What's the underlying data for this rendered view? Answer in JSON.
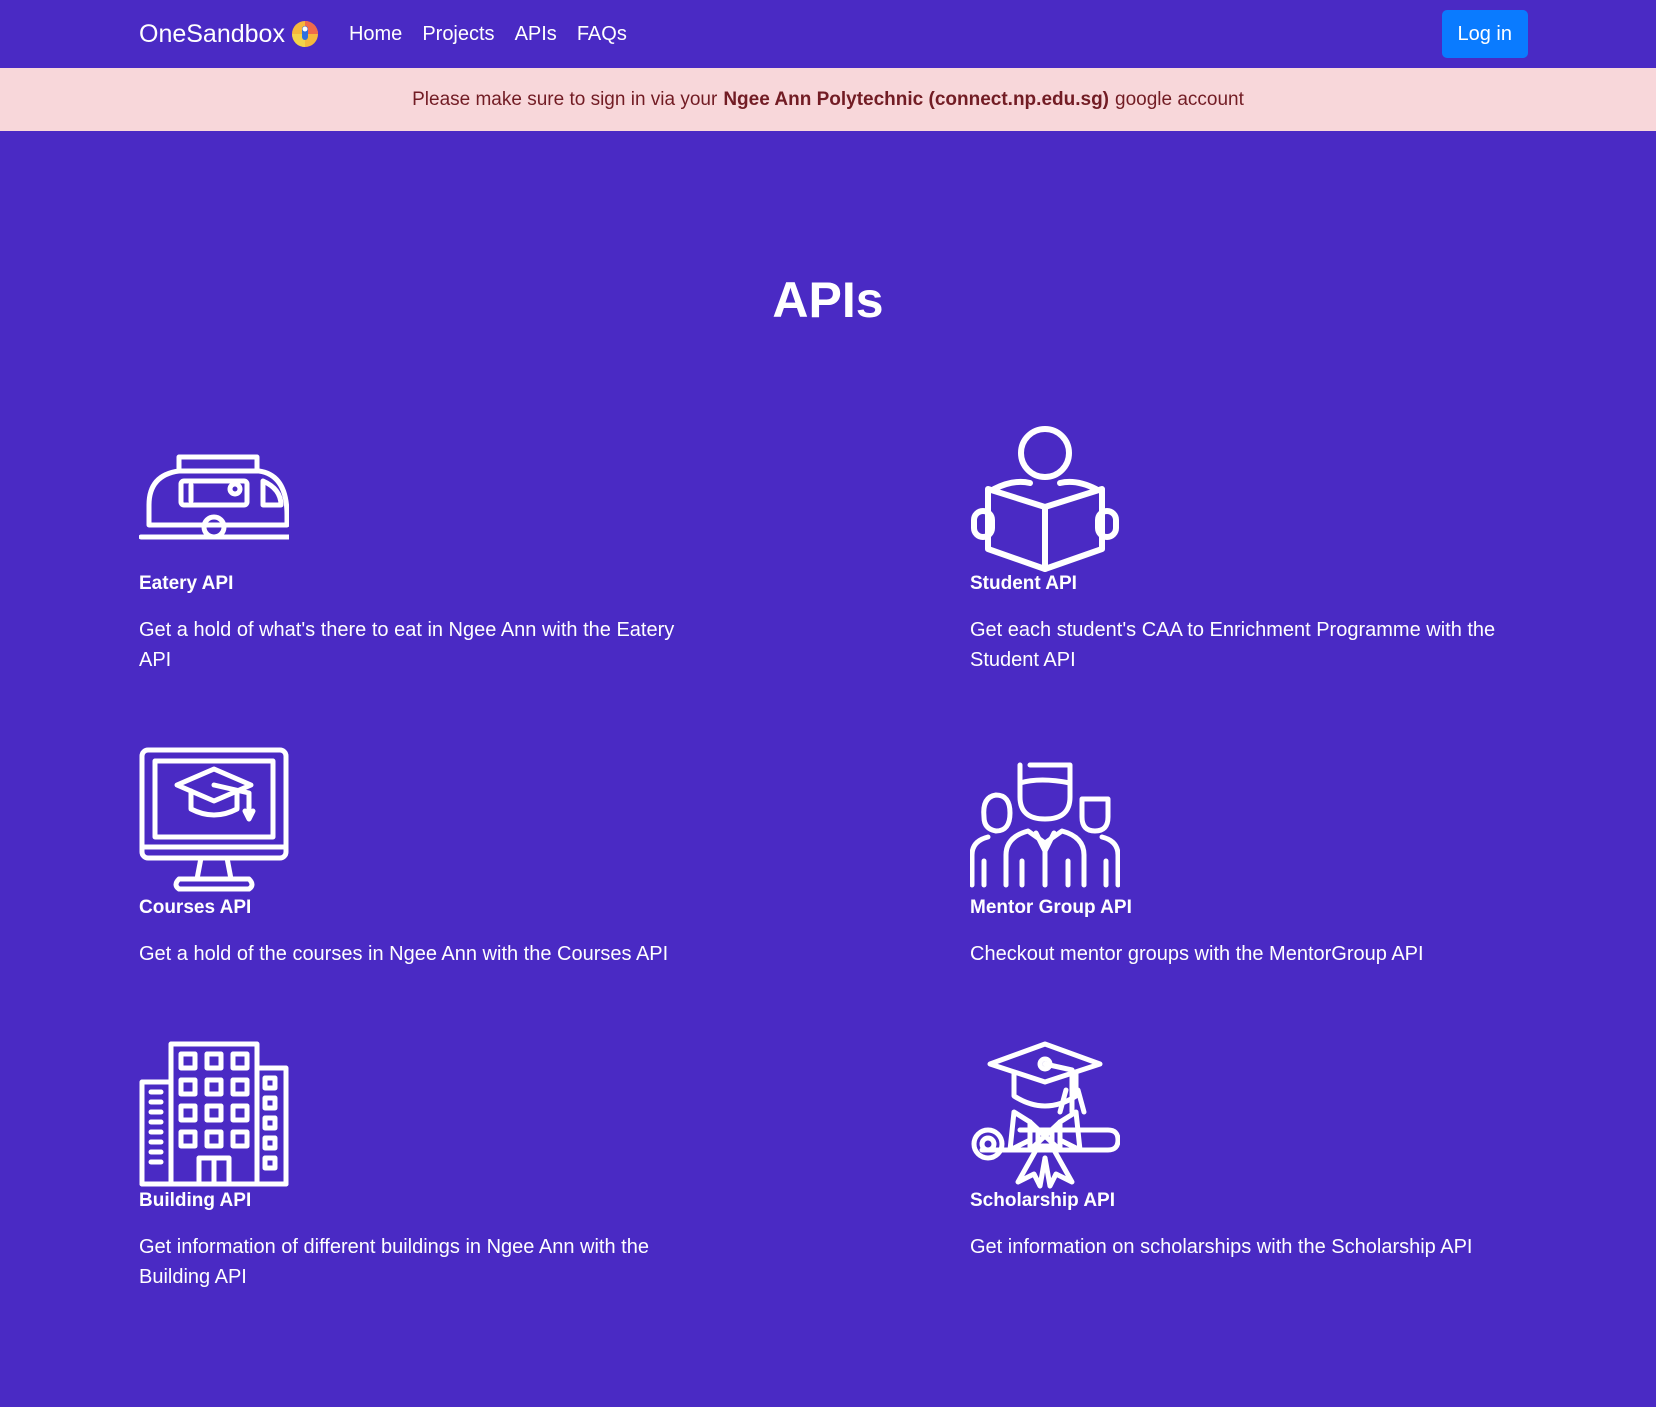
{
  "navbar": {
    "brand": "OneSandbox",
    "links": [
      "Home",
      "Projects",
      "APIs",
      "FAQs"
    ],
    "login_label": "Log in"
  },
  "alert": {
    "prefix": "Please make sure to sign in via your",
    "bold": "Ngee Ann Polytechnic (connect.np.edu.sg)",
    "suffix": "google account"
  },
  "page": {
    "title": "APIs"
  },
  "apis": [
    {
      "icon": "food-truck-icon",
      "name": "Eatery API",
      "desc": "Get a hold of what's there to eat in Ngee Ann with the Eatery API"
    },
    {
      "icon": "student-reading-icon",
      "name": "Student API",
      "desc": "Get each student's CAA to Enrichment Programme with the Student API"
    },
    {
      "icon": "online-course-icon",
      "name": "Courses API",
      "desc": "Get a hold of the courses in Ngee Ann with the Courses API"
    },
    {
      "icon": "mentor-group-icon",
      "name": "Mentor Group API",
      "desc": "Checkout mentor groups with the MentorGroup API"
    },
    {
      "icon": "building-icon",
      "name": "Building API",
      "desc": "Get information of different buildings in Ngee Ann with the Building API"
    },
    {
      "icon": "graduation-diploma-icon",
      "name": "Scholarship API",
      "desc": "Get information on scholarships with the Scholarship API"
    }
  ]
}
